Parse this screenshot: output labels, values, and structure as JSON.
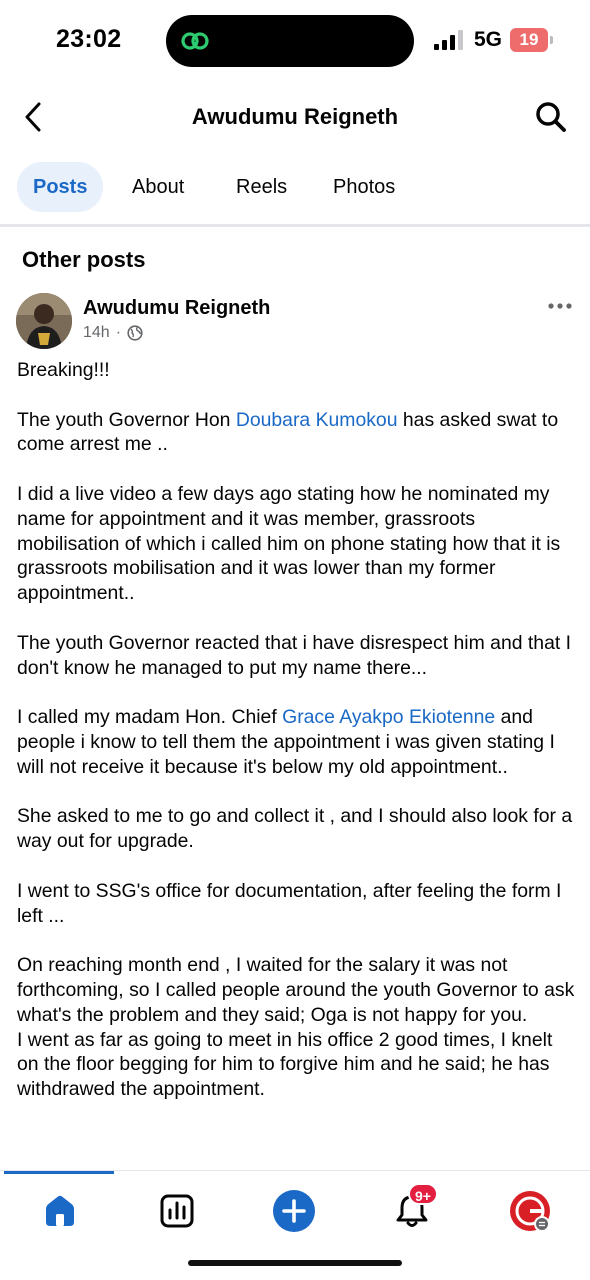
{
  "status_bar": {
    "time": "23:02",
    "network": "5G",
    "battery": "19",
    "icons": [
      "link-app-icon",
      "signal-icon",
      "battery-icon"
    ]
  },
  "header": {
    "title": "Awudumu Reigneth",
    "icons": [
      "back-chevron-icon",
      "search-icon"
    ]
  },
  "tabs": [
    {
      "label": "Posts",
      "active": true
    },
    {
      "label": "About",
      "active": false
    },
    {
      "label": "Reels",
      "active": false
    },
    {
      "label": "Photos",
      "active": false
    }
  ],
  "section": {
    "title": "Other posts"
  },
  "post": {
    "author": "Awudumu Reigneth",
    "time": "14h",
    "separator": "·",
    "privacy_icon": "globe-icon",
    "paragraphs": {
      "p1": "Breaking!!!",
      "p2_pre": "The youth Governor Hon ",
      "p2_link": "Doubara Kumokou",
      "p2_post": " has asked swat to come arrest me ..",
      "p3": "I did a live video a few days ago stating how he nominated my name for appointment and it was member, grassroots mobilisation of which i called him on phone stating how that it is grassroots mobilisation and it was lower than my former appointment..",
      "p4": "The youth Governor reacted that i have disrespect him and that I don't know he managed to put my name there...",
      "p5_pre": "I called my madam Hon. Chief ",
      "p5_link": "Grace Ayakpo Ekiotenne",
      "p5_post": " and people i know to tell them the appointment i was given stating I will not receive it because it's below my old appointment..",
      "p6": "She asked to me to go and collect it , and I should also look for a way out for upgrade.",
      "p7": "I went to SSG's office for documentation, after feeling the form  I left ...",
      "p8": "On reaching month end , I waited for the salary it was not forthcoming, so I called people around the youth Governor to ask what's the problem and they said; Oga is not happy for you.",
      "p9": "I went as far as going to meet in his office 2 good times, I knelt on the floor begging for him to forgive him and he said; he has withdrawed the appointment."
    }
  },
  "bottom_nav": {
    "items": [
      "home-icon",
      "dashboard-icon",
      "create-icon",
      "notifications-icon",
      "profile-icon"
    ],
    "notification_badge": "9+",
    "active_color": "#1b69c7"
  },
  "colors": {
    "accent": "#1b69c7",
    "badge": "#e41e3f",
    "battery": "#ef6c6c"
  }
}
